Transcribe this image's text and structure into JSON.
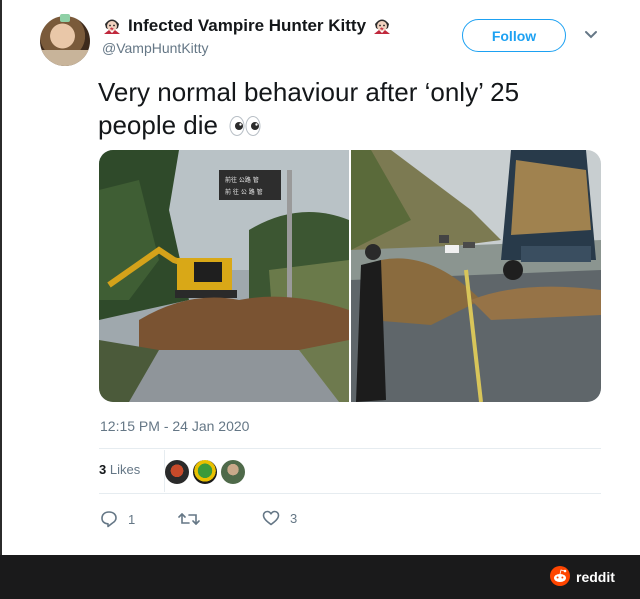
{
  "tweet": {
    "display_name": "Infected Vampire Hunter Kitty",
    "handle": "@VampHuntKitty",
    "follow_label": "Follow",
    "text_line1": "Very normal behaviour after ‘only’ 25",
    "text_line2": "people die",
    "timestamp": "12:15 PM - 24 Jan 2020",
    "likes_count": "3",
    "likes_label": "Likes",
    "reply_count": "1",
    "retweet_count": "",
    "like_count": "3",
    "sign_text_line1": "前往 公路 管",
    "sign_text_line2": "前 往 公 路 管"
  },
  "footer": {
    "brand": "reddit"
  },
  "colors": {
    "accent": "#1da1f2",
    "muted": "#657786",
    "footer_bg": "#1a1a1b",
    "reddit_orange": "#ff4500"
  },
  "icons": [
    "vampire-emoji-icon",
    "eyes-emoji-icon",
    "chevron-down-icon",
    "reply-icon",
    "retweet-icon",
    "heart-icon",
    "reddit-logo-icon"
  ]
}
